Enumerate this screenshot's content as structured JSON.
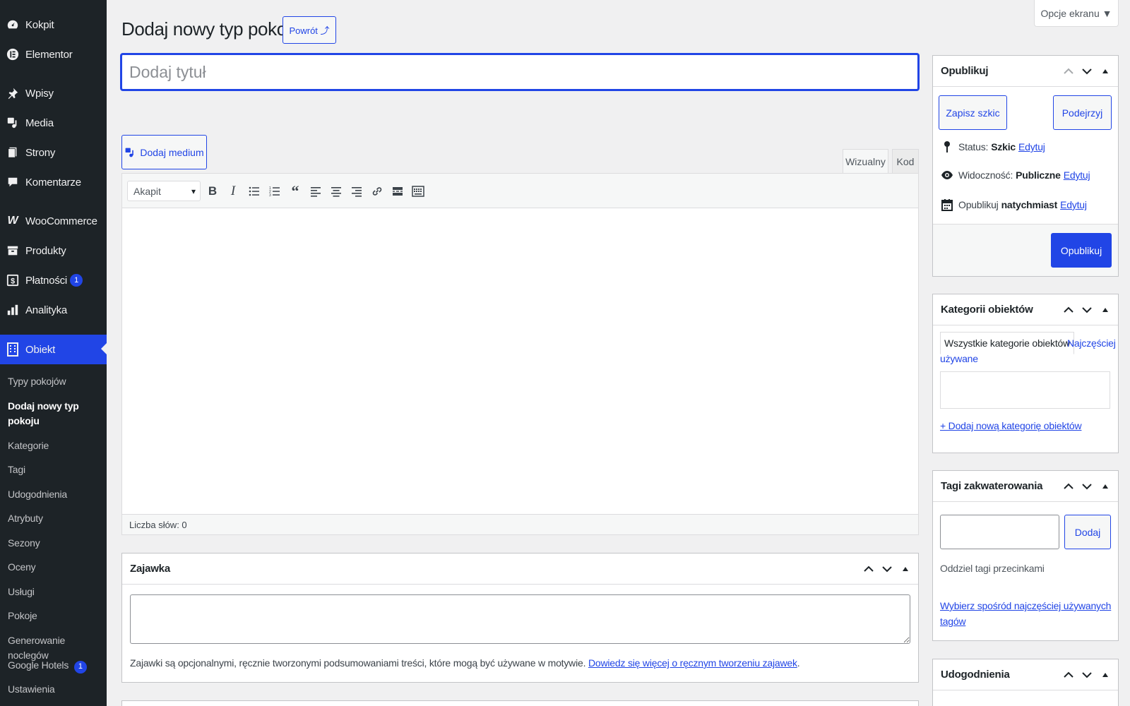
{
  "sidebar": {
    "items": [
      {
        "label": "Kokpit",
        "icon": "dashboard-icon"
      },
      {
        "label": "Elementor",
        "icon": "elementor-icon"
      },
      {
        "label": "Wpisy",
        "icon": "pin-icon"
      },
      {
        "label": "Media",
        "icon": "media-icon"
      },
      {
        "label": "Strony",
        "icon": "page-icon"
      },
      {
        "label": "Komentarze",
        "icon": "comment-icon"
      },
      {
        "label": "WooCommerce",
        "icon": "woocommerce-icon"
      },
      {
        "label": "Produkty",
        "icon": "archive-icon"
      },
      {
        "label": "Płatności",
        "icon": "dollar-icon",
        "badge": "1"
      },
      {
        "label": "Analityka",
        "icon": "chart-icon"
      },
      {
        "label": "Obiekt",
        "icon": "building-icon"
      }
    ],
    "submenu": [
      "Typy pokojów",
      "Dodaj nowy typ pokoju",
      "Kategorie",
      "Tagi",
      "Udogodnienia",
      "Atrybuty",
      "Sezony",
      "Oceny",
      "Usługi",
      "Pokoje",
      "Generowanie noclegów",
      "Google Hotels",
      "Ustawienia"
    ],
    "submenu_badge_google": "1"
  },
  "header": {
    "title": "Dodaj nowy typ pokoju",
    "back_button": "Powrót ⤴",
    "screen_options": "Opcje ekranu ▼"
  },
  "title_input": {
    "placeholder": "Dodaj tytuł"
  },
  "editor": {
    "add_media": "Dodaj medium",
    "tab_visual": "Wizualny",
    "tab_code": "Kod",
    "format_select": "Akapit",
    "word_count": "Liczba słów: 0"
  },
  "excerpt": {
    "title": "Zajawka",
    "help_text": "Zajawki są opcjonalnymi, ręcznie tworzonymi podsumowaniami treści, które mogą być używane w motywie.",
    "help_link": "Dowiedz się więcej o ręcznym tworzeniu zajawek",
    "help_end": "."
  },
  "publish": {
    "title": "Opublikuj",
    "save_draft": "Zapisz szkic",
    "preview": "Podejrzyj",
    "status_label": "Status:",
    "status_value": "Szkic",
    "visibility_label": "Widoczność:",
    "visibility_value": "Publiczne",
    "publish_label": "Opublikuj",
    "publish_value": "natychmiast",
    "edit": "Edytuj",
    "publish_button": "Opublikuj"
  },
  "categories": {
    "title": "Kategorii obiektów",
    "tab_all": "Wszystkie kategorie obiektów",
    "tab_popular_1": "Najczęściej",
    "tab_popular_2": "używane",
    "add_new": "+ Dodaj nową kategorię obiektów"
  },
  "tags": {
    "title": "Tagi zakwaterowania",
    "add_button": "Dodaj",
    "help": "Oddziel tagi przecinkami",
    "choose_1": "Wybierz spośród najczęściej używanych",
    "choose_2": "tagów"
  },
  "amenities": {
    "title": "Udogodnienia"
  },
  "colors": {
    "accent": "#2145e6",
    "sidebar_bg": "#1d2327"
  }
}
